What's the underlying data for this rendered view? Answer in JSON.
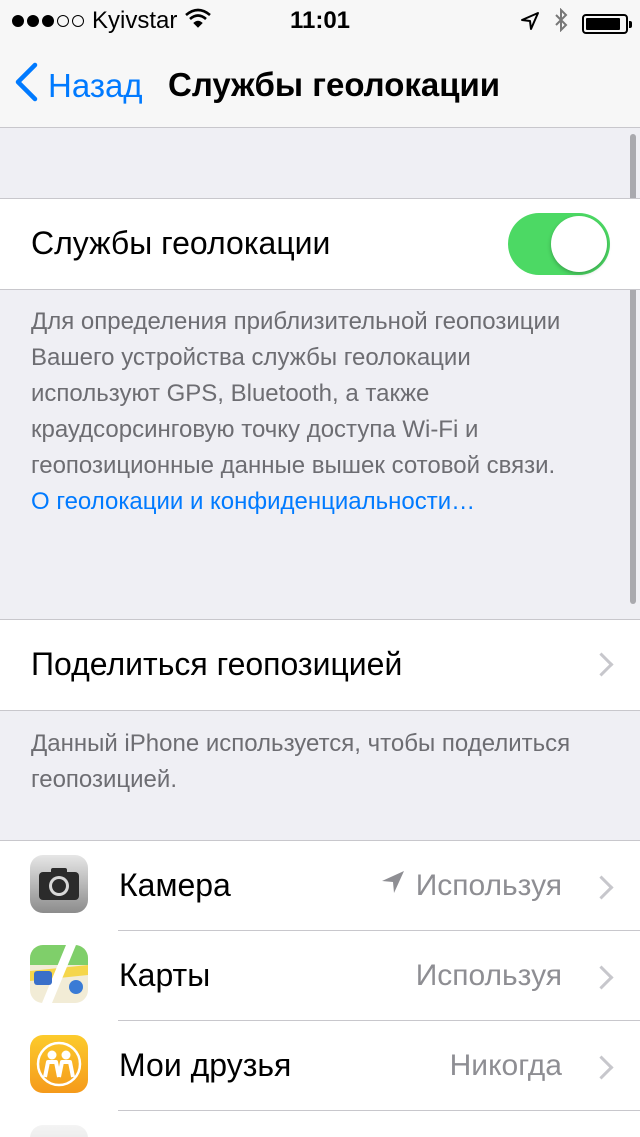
{
  "status_bar": {
    "carrier": "Kyivstar",
    "time": "11:01",
    "signal_filled": 3,
    "signal_total": 5,
    "icons": [
      "wifi-icon",
      "location-arrow-icon",
      "bluetooth-icon",
      "battery-icon"
    ],
    "battery_level": 0.9
  },
  "nav": {
    "back_label": "Назад",
    "title": "Службы геолокации"
  },
  "location_services": {
    "label": "Службы геолокации",
    "enabled": true,
    "description": "Для определения приблизительной геопозиции Вашего устройства службы геолокации используют GPS, Bluetooth, а также краудсорсинговую точку доступа Wi-Fi и геопозиционные данные вышек сотовой связи.",
    "privacy_link": "О геолокации и конфиденциальности…"
  },
  "share_location": {
    "label": "Поделиться геопозицией",
    "footer": "Данный iPhone используется, чтобы поделиться геопозицией."
  },
  "apps": [
    {
      "name": "Камера",
      "value": "Используя",
      "icon": "camera-icon",
      "recent_use_arrow": true
    },
    {
      "name": "Карты",
      "value": "Используя",
      "icon": "maps-icon",
      "recent_use_arrow": false
    },
    {
      "name": "Мои друзья",
      "value": "Никогда",
      "icon": "find-friends-icon",
      "recent_use_arrow": false
    }
  ],
  "colors": {
    "accent": "#007aff",
    "toggle_on": "#4cd964",
    "background": "#efeff4",
    "secondary_text": "#8e8e93"
  }
}
